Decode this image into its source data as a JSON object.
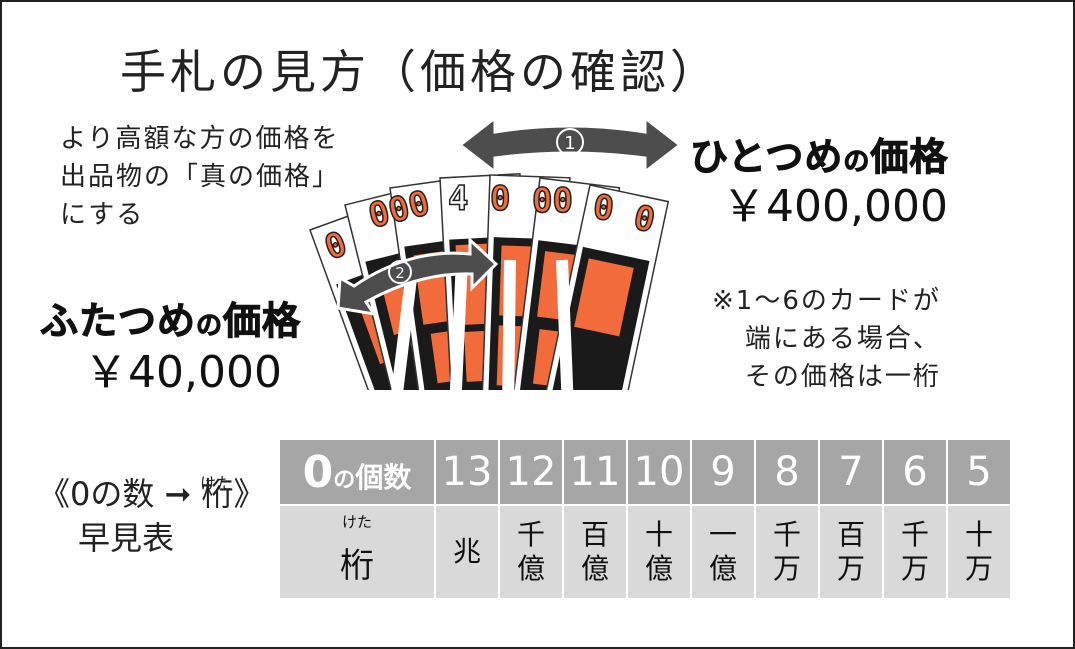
{
  "title": "手札の見方（価格の確認）",
  "note_left": [
    "より高額な方の価格を",
    "出品物の「真の価格」",
    "にする"
  ],
  "first_price": {
    "label_main": "ひとつめ",
    "label_no": "の",
    "label_end": "価格",
    "value": "￥400,000"
  },
  "second_price": {
    "label_main": "ふたつめ",
    "label_no": "の",
    "label_end": "価格",
    "value": "￥40,000"
  },
  "note_right": [
    "※1～6のカードが",
    "端にある場合、",
    "その価格は一桁"
  ],
  "arrows": {
    "first": "①",
    "second": "②"
  },
  "cards_digits": "4000000",
  "legend": {
    "line1_pre": "《0の数 ➞ ",
    "line1_kanji": "桁",
    "line1_post": "》",
    "ruby": "けた",
    "line2": "早見表"
  },
  "table": {
    "header_first_zero": "0",
    "header_first_no": "の",
    "header_first_rest": "個数",
    "counts": [
      "13",
      "12",
      "11",
      "10",
      "9",
      "8",
      "7",
      "6",
      "5"
    ],
    "body_first_ruby": "けた",
    "body_first": "桁",
    "units": [
      [
        "兆"
      ],
      [
        "千",
        "億"
      ],
      [
        "百",
        "億"
      ],
      [
        "十",
        "億"
      ],
      [
        "一",
        "億"
      ],
      [
        "千",
        "万"
      ],
      [
        "百",
        "万"
      ],
      [
        "千",
        "万"
      ],
      [
        "十",
        "万"
      ]
    ]
  },
  "colors": {
    "card_orange": "#f26b3a",
    "card_black": "#1a1a1a",
    "arrow_gray": "#4d4d4d",
    "header_gray": "#a6a6a6",
    "cell_gray": "#d9d9d9"
  }
}
